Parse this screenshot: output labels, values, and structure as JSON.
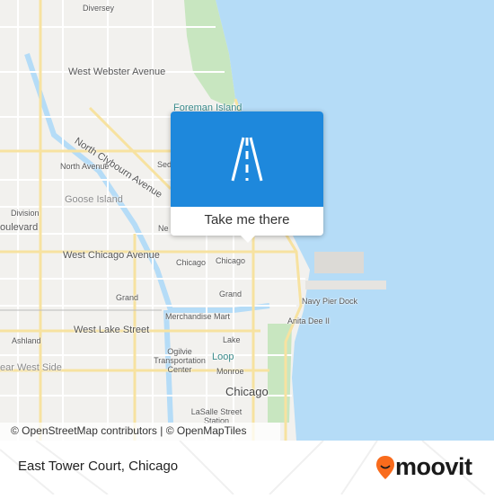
{
  "map": {
    "labels": [
      {
        "text": "Diversey",
        "cls": "sm"
      },
      {
        "text": "West Webster Avenue",
        "cls": ""
      },
      {
        "text": "Foreman Island",
        "cls": "blue"
      },
      {
        "text": "North Clybourn Avenue",
        "cls": ""
      },
      {
        "text": "North Avenue",
        "cls": "sm"
      },
      {
        "text": "Sed",
        "cls": "sm"
      },
      {
        "text": "Goose Island",
        "cls": "gray"
      },
      {
        "text": "Division",
        "cls": "sm"
      },
      {
        "text": "oulevard",
        "cls": ""
      },
      {
        "text": "Ne",
        "cls": "sm"
      },
      {
        "text": "West Chicago Avenue",
        "cls": ""
      },
      {
        "text": "Chicago",
        "cls": "sm"
      },
      {
        "text": "Chicago",
        "cls": "sm"
      },
      {
        "text": "Grand",
        "cls": "sm"
      },
      {
        "text": "Grand",
        "cls": "sm"
      },
      {
        "text": "Navy Pier Dock",
        "cls": "sm"
      },
      {
        "text": "Merchandise Mart",
        "cls": "sm"
      },
      {
        "text": "Anita Dee II",
        "cls": "sm"
      },
      {
        "text": "West Lake Street",
        "cls": ""
      },
      {
        "text": "Ashland",
        "cls": "sm"
      },
      {
        "text": "Lake",
        "cls": "sm"
      },
      {
        "text": "Ogilvie Transportation Center",
        "cls": "sm"
      },
      {
        "text": "Loop",
        "cls": "blue"
      },
      {
        "text": "ear West Side",
        "cls": "gray"
      },
      {
        "text": "Monroe",
        "cls": "sm"
      },
      {
        "text": "Chicago",
        "cls": "big"
      },
      {
        "text": "LaSalle Street Station",
        "cls": "sm"
      }
    ],
    "water_color": "#b5dcf7",
    "park_color": "#c8e6c0"
  },
  "popup": {
    "button_label": "Take me there",
    "header_color": "#1e88dc",
    "icon": "road-icon"
  },
  "attribution": "© OpenStreetMap contributors | © OpenMapTiles",
  "footer": {
    "place": "East Tower Court, Chicago",
    "brand": "moovit",
    "brand_color": "#f96b1c"
  }
}
